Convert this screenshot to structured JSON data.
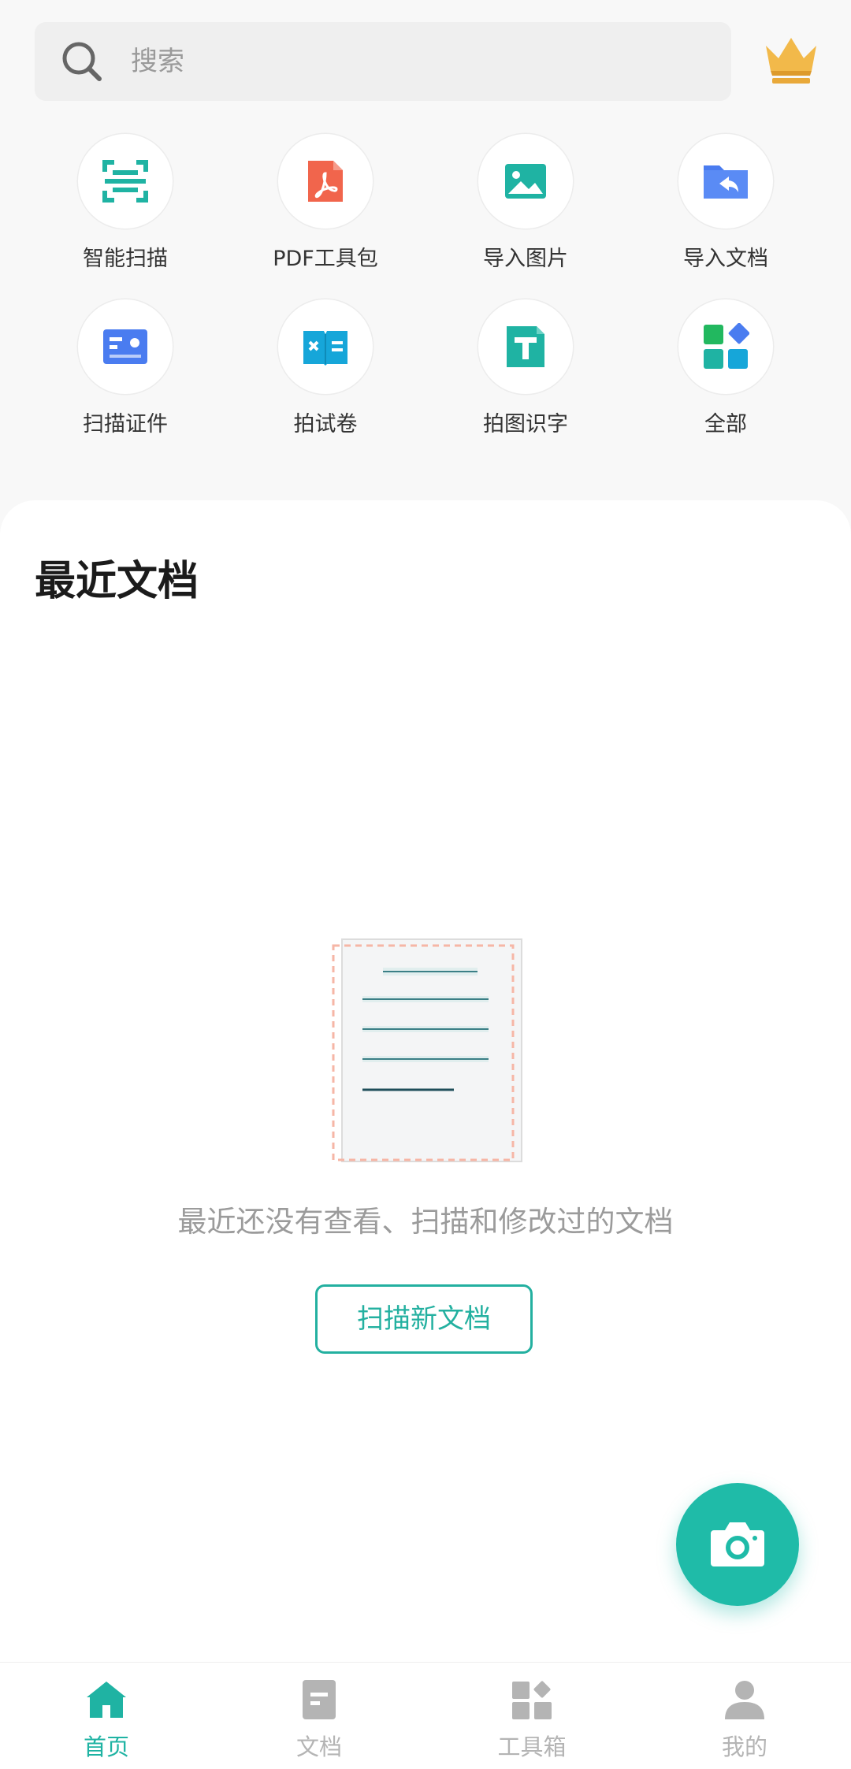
{
  "search": {
    "placeholder": "搜索"
  },
  "header": {
    "vip_icon": "crown-icon"
  },
  "tools": [
    {
      "label": "智能扫描",
      "icon": "smart-scan-icon",
      "color": "#1fb3a3"
    },
    {
      "label": "PDF工具包",
      "icon": "pdf-icon",
      "color": "#f1654c"
    },
    {
      "label": "导入图片",
      "icon": "image-icon",
      "color": "#1fb3a3"
    },
    {
      "label": "导入文档",
      "icon": "folder-import-icon",
      "color": "#4a7cf0"
    },
    {
      "label": "扫描证件",
      "icon": "id-card-icon",
      "color": "#4a7cf0"
    },
    {
      "label": "拍试卷",
      "icon": "exam-book-icon",
      "color": "#16a6d9"
    },
    {
      "label": "拍图识字",
      "icon": "text-ocr-icon",
      "color": "#1fb3a3"
    },
    {
      "label": "全部",
      "icon": "all-apps-icon",
      "color": "#4a7cf0"
    }
  ],
  "recent": {
    "title": "最近文档",
    "empty_text": "最近还没有查看、扫描和修改过的文档",
    "scan_button": "扫描新文档"
  },
  "fab": {
    "icon": "camera-icon"
  },
  "nav": [
    {
      "label": "首页",
      "icon": "home-icon",
      "active": true
    },
    {
      "label": "文档",
      "icon": "document-icon",
      "active": false
    },
    {
      "label": "工具箱",
      "icon": "toolbox-icon",
      "active": false
    },
    {
      "label": "我的",
      "icon": "user-icon",
      "active": false
    }
  ],
  "colors": {
    "accent": "#1fb3a3",
    "inactive": "#b4b4b4",
    "vip": "#e9a93a"
  }
}
